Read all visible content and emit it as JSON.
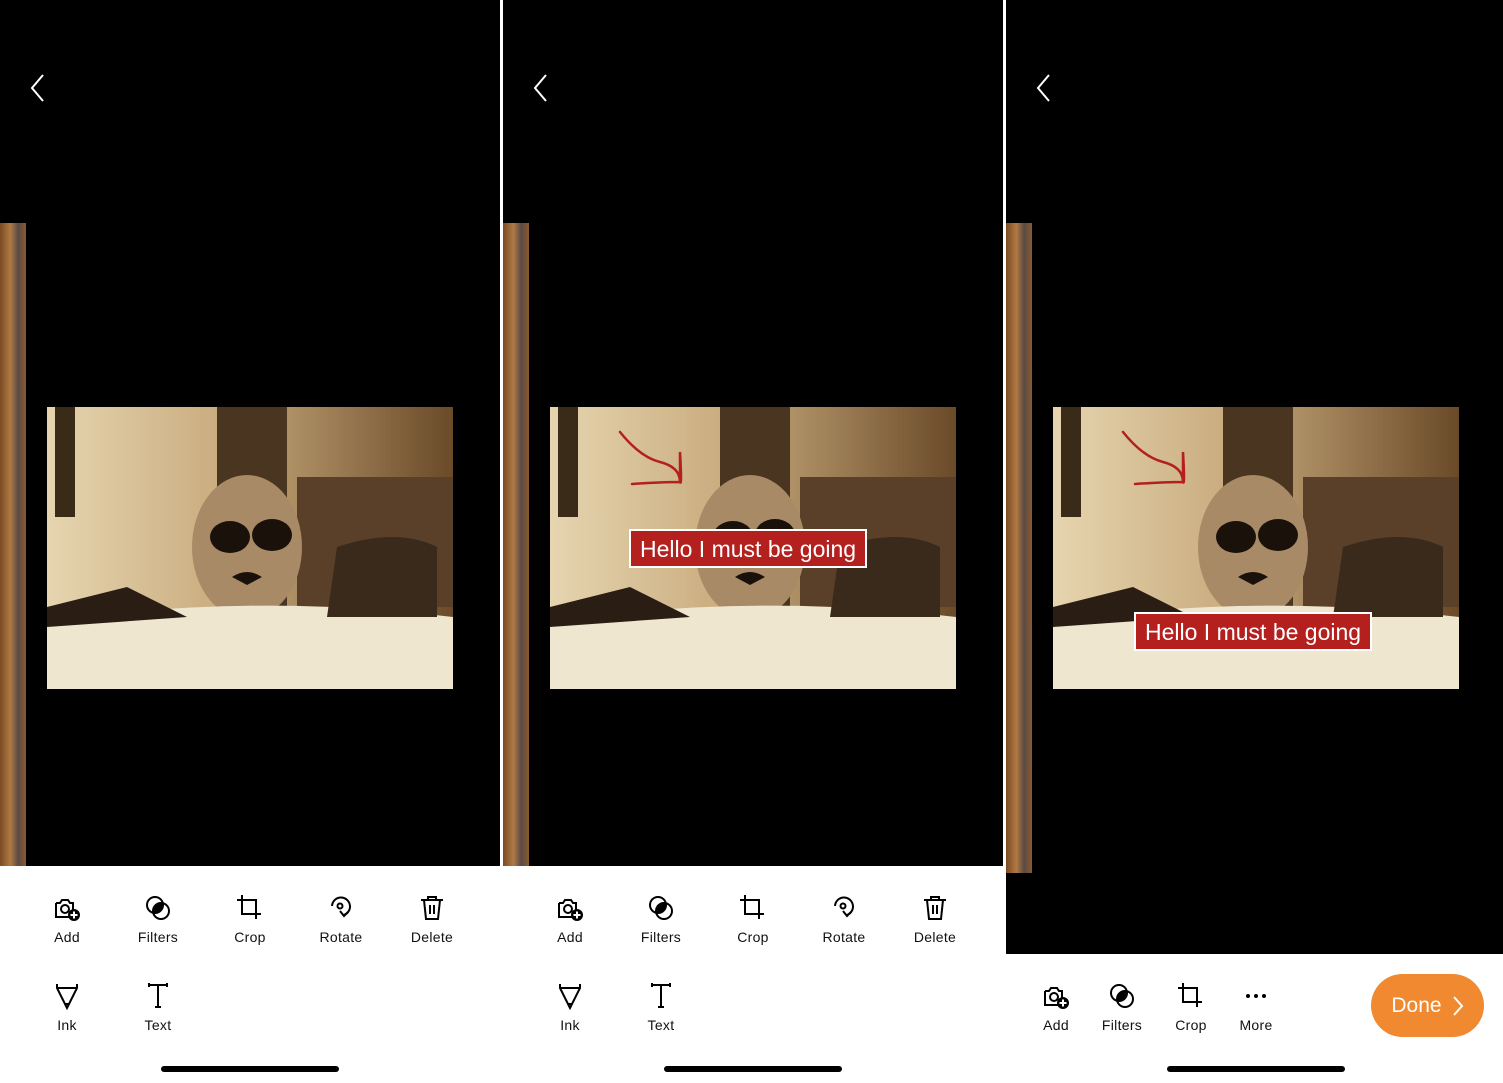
{
  "panels": [
    {
      "id": "edit",
      "text_label": null,
      "ink": false,
      "toolbar": [
        {
          "label": "Add",
          "icon": "camera-add-icon"
        },
        {
          "label": "Filters",
          "icon": "filters-icon"
        },
        {
          "label": "Crop",
          "icon": "crop-icon"
        },
        {
          "label": "Rotate",
          "icon": "rotate-icon"
        },
        {
          "label": "Delete",
          "icon": "trash-icon"
        },
        {
          "label": "Ink",
          "icon": "ink-pen-icon"
        },
        {
          "label": "Text",
          "icon": "text-icon"
        }
      ]
    },
    {
      "id": "edit-annotated",
      "text_label": "Hello I must be going",
      "ink": true,
      "toolbar": [
        {
          "label": "Add",
          "icon": "camera-add-icon"
        },
        {
          "label": "Filters",
          "icon": "filters-icon"
        },
        {
          "label": "Crop",
          "icon": "crop-icon"
        },
        {
          "label": "Rotate",
          "icon": "rotate-icon"
        },
        {
          "label": "Delete",
          "icon": "trash-icon"
        },
        {
          "label": "Ink",
          "icon": "ink-pen-icon"
        },
        {
          "label": "Text",
          "icon": "text-icon"
        }
      ]
    },
    {
      "id": "review",
      "text_label": "Hello I must be going",
      "ink": true,
      "toolbar": [
        {
          "label": "Add",
          "icon": "camera-add-icon"
        },
        {
          "label": "Filters",
          "icon": "filters-icon"
        },
        {
          "label": "Crop",
          "icon": "crop-icon"
        },
        {
          "label": "More",
          "icon": "more-icon"
        }
      ],
      "done_label": "Done"
    }
  ],
  "colors": {
    "accent": "#f0892f",
    "text_label_bg": "#b3201e",
    "ink": "#b3201e"
  }
}
